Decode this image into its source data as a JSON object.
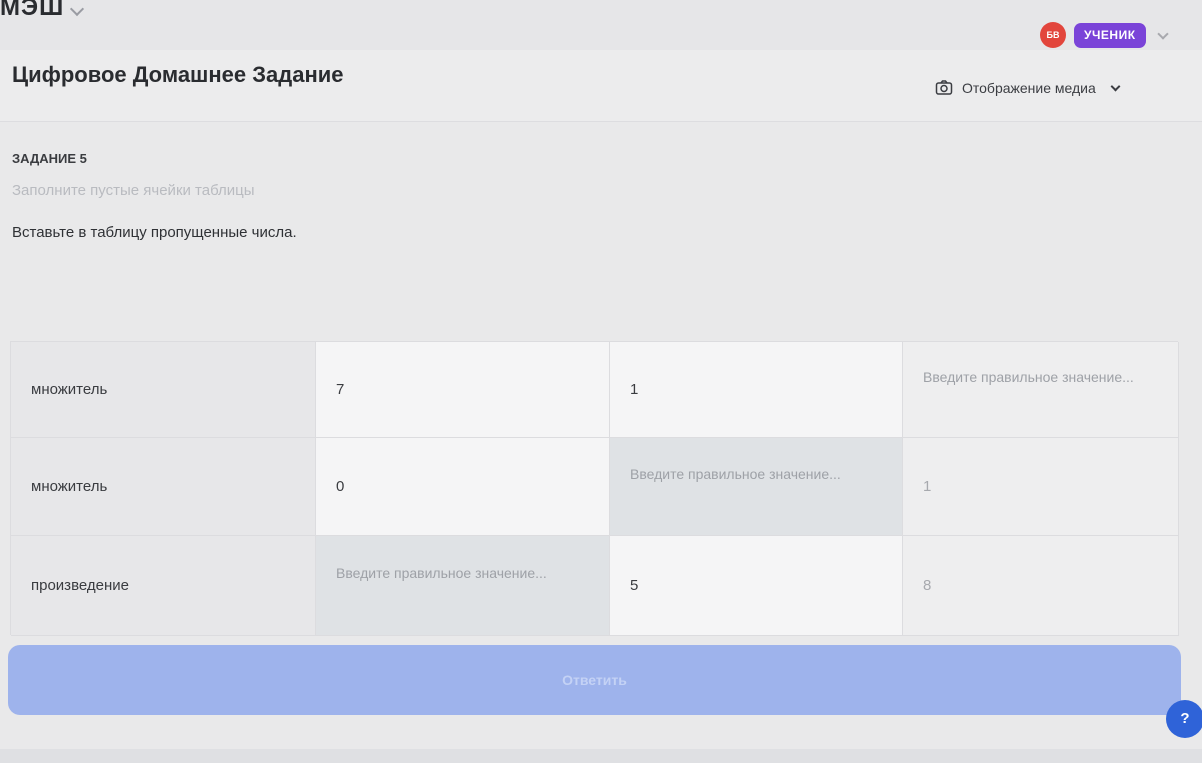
{
  "app": {
    "brand": "МЭШ"
  },
  "user": {
    "initials": "БВ",
    "role": "УЧЕНИК"
  },
  "header": {
    "title": "Цифровое Домашнее Задание",
    "media_toggle": "Отображение медиа"
  },
  "task": {
    "label": "ЗАДАНИЕ 5",
    "hint": "Заполните пустые ячейки таблицы",
    "text": "Вставьте в таблицу пропущенные числа."
  },
  "table": {
    "placeholder": "Введите правильное значение...",
    "rows": [
      {
        "label": "множитель",
        "cells": [
          "7",
          "1",
          ""
        ]
      },
      {
        "label": "множитель",
        "cells": [
          "0",
          "",
          "1"
        ]
      },
      {
        "label": "произведение",
        "cells": [
          "",
          "5",
          "8"
        ]
      }
    ]
  },
  "actions": {
    "submit": "Ответить",
    "help": "?"
  },
  "colors": {
    "accent": "#7a43d8",
    "avatar": "#e2453c",
    "submit": "#9eb3ec",
    "help": "#2f63d8"
  }
}
